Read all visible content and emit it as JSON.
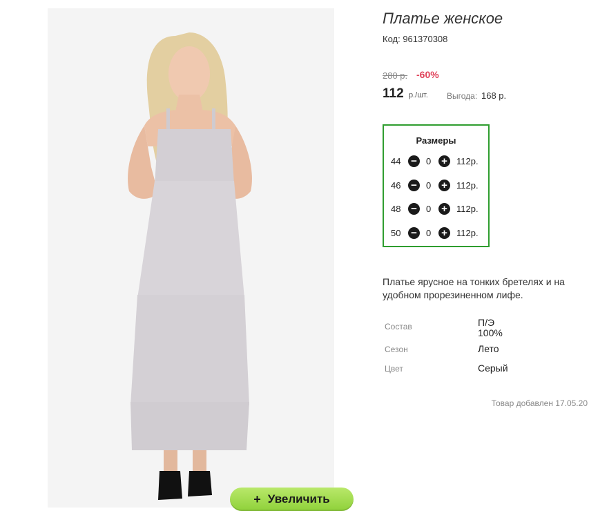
{
  "product": {
    "title": "Платье женское",
    "code": "Код: 961370308",
    "image_alt_icon": "dress-photo"
  },
  "price": {
    "old": "280 р.",
    "discount": "-60%",
    "current": "112",
    "unit": "р./шт.",
    "saving_label": "Выгода:",
    "saving_value": "168 р.",
    "discount_color": "#e0435a"
  },
  "sizes": {
    "title": "Размеры",
    "border_color": "#2f9d2f",
    "rows": [
      {
        "size": "44",
        "qty": "0",
        "price": "112р."
      },
      {
        "size": "46",
        "qty": "0",
        "price": "112р."
      },
      {
        "size": "48",
        "qty": "0",
        "price": "112р."
      },
      {
        "size": "50",
        "qty": "0",
        "price": "112р."
      }
    ],
    "minus_icon": "minus-circle-icon",
    "plus_icon": "plus-circle-icon"
  },
  "description": "Платье ярусное на тонких бретелях и на удобном прорезиненном лифе.",
  "attributes": [
    {
      "label": "Состав",
      "value_line1": "П/Э",
      "value_line2": "100%"
    },
    {
      "label": "Сезон",
      "value_line1": "Лето"
    },
    {
      "label": "Цвет",
      "value_line1": "Серый"
    }
  ],
  "added": "Товар добавлен 17.05.20",
  "zoom": {
    "plus": "+",
    "label": "Увеличить",
    "color": "#8fd13a"
  }
}
